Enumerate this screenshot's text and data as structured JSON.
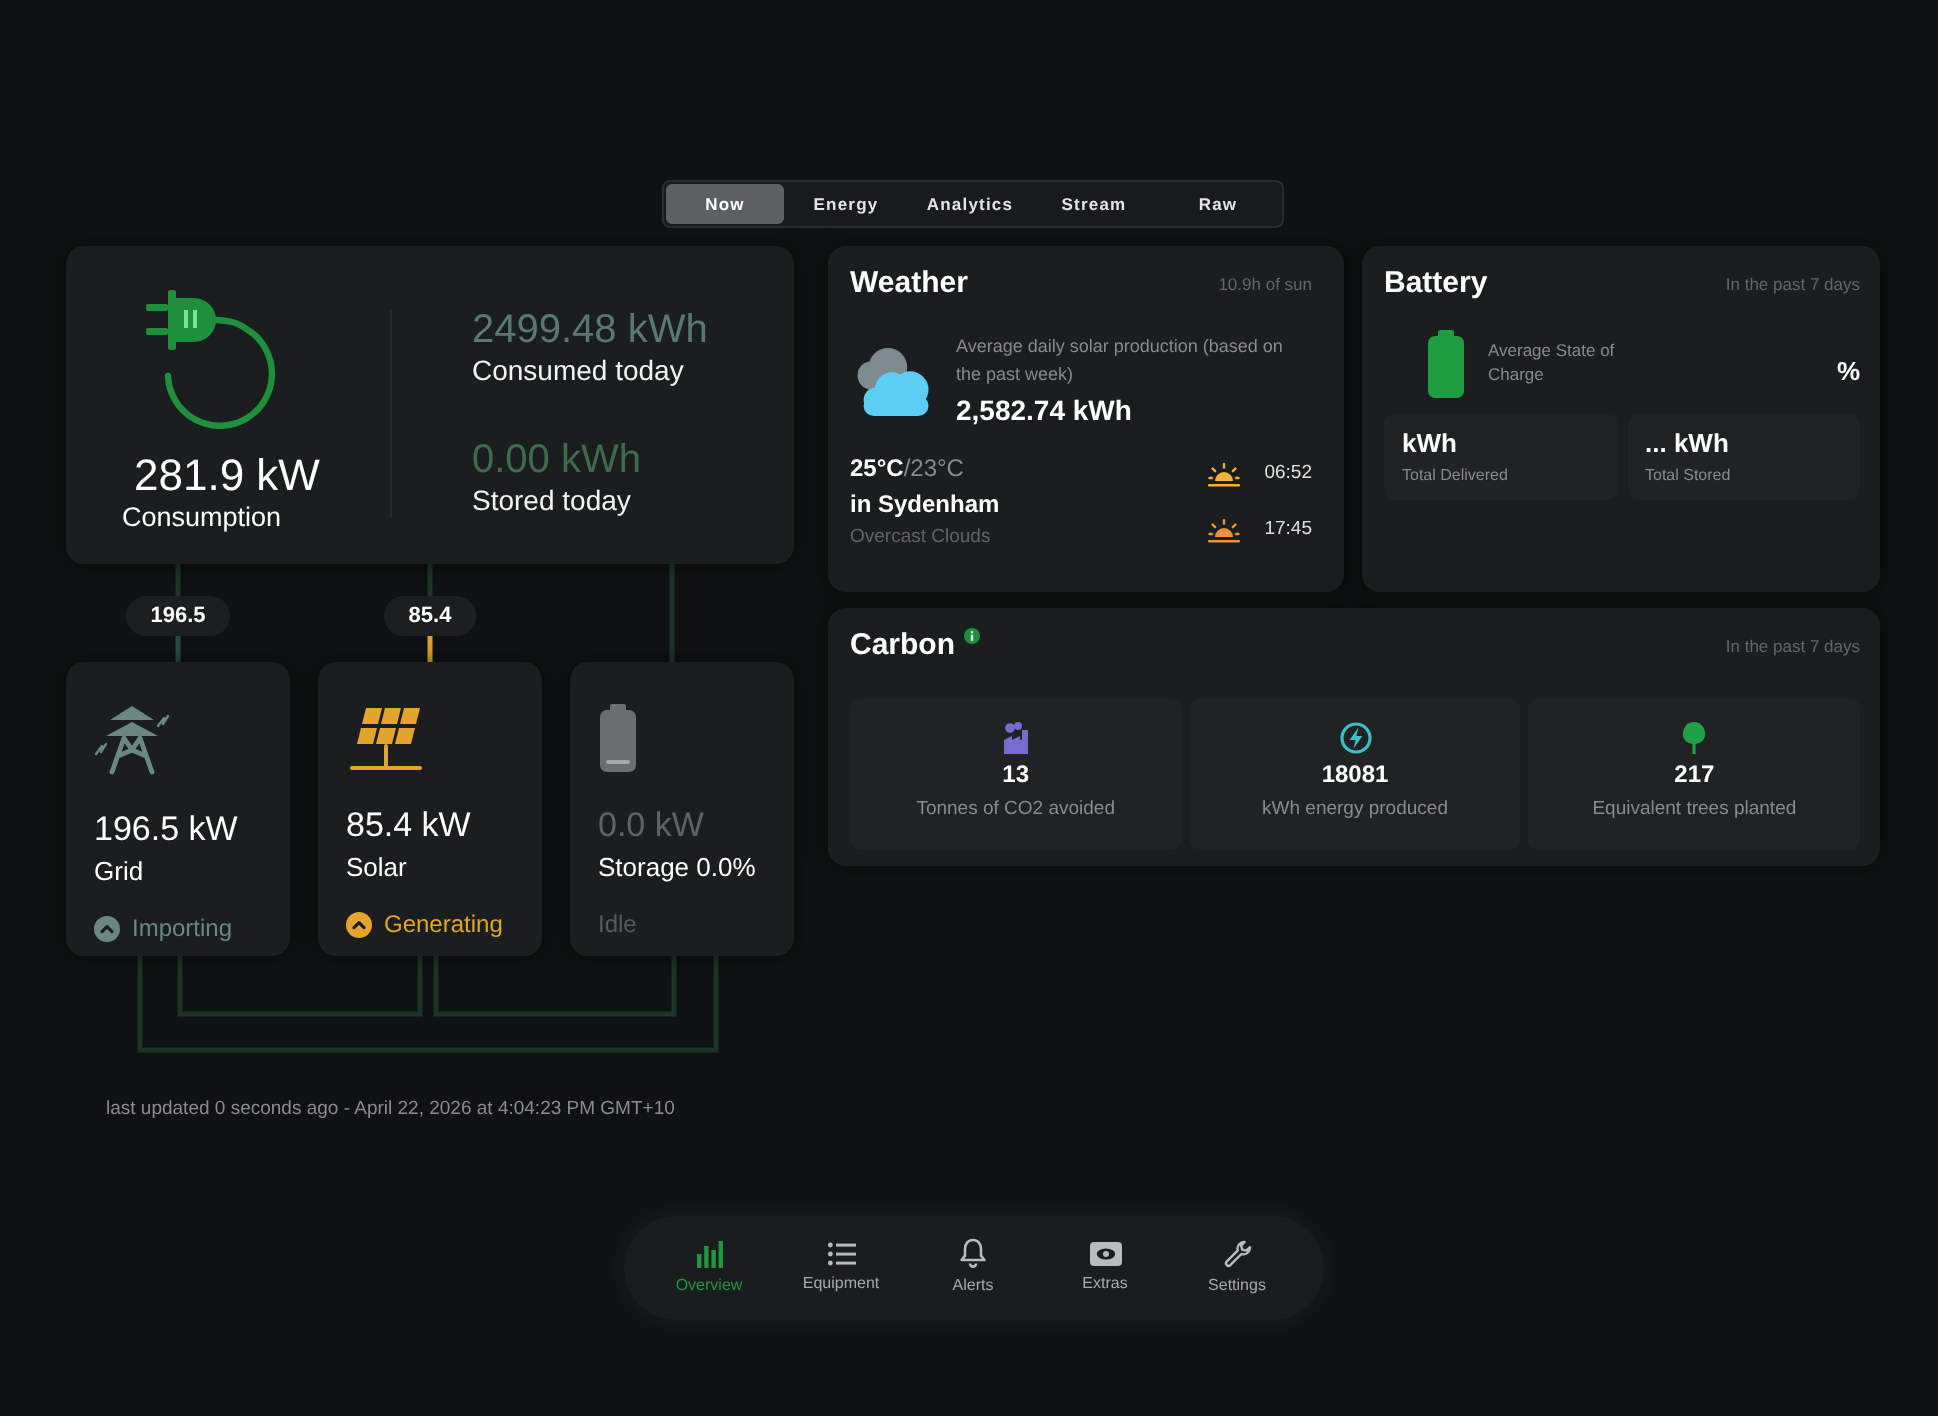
{
  "tabs": [
    {
      "label": "Now",
      "selected": true
    },
    {
      "label": "Energy",
      "selected": false
    },
    {
      "label": "Analytics",
      "selected": false
    },
    {
      "label": "Stream",
      "selected": false
    },
    {
      "label": "Raw",
      "selected": false
    }
  ],
  "consumption": {
    "value": "281.9 kW",
    "label": "Consumption",
    "stats": [
      {
        "value": "2499.48 kWh",
        "label": "Consumed today"
      },
      {
        "value": "0.00 kWh",
        "label": "Stored today"
      }
    ]
  },
  "flow": {
    "badges": [
      {
        "kind": "grid",
        "value": "196.5"
      },
      {
        "kind": "solar",
        "value": "85.4"
      }
    ],
    "sources": [
      {
        "kind": "grid",
        "color": "#6a8780",
        "value": "196.5 kW",
        "label": "Grid",
        "status": "Importing",
        "active": true
      },
      {
        "kind": "solar",
        "color": "#e3a52b",
        "value": "85.4 kW",
        "label": "Solar",
        "status": "Generating",
        "active": true
      },
      {
        "kind": "storage",
        "color": "#6b6e6e",
        "value": "0.0 kW",
        "label": "Storage 0.0%",
        "status": "Idle",
        "active": false
      }
    ]
  },
  "weather": {
    "title": "Weather",
    "note": "10.9h of sun",
    "description": "Average daily solar production (based on the past week)",
    "production": "2,582.74 kWh",
    "temp_high": "25°C",
    "temp_low": "/23°C",
    "location": "in Sydenham",
    "condition": "Overcast Clouds",
    "sun_times": [
      {
        "kind": "sunrise",
        "time": "06:52"
      },
      {
        "kind": "sunset",
        "time": "17:45"
      }
    ]
  },
  "battery": {
    "title": "Battery",
    "note": "In the past 7 days",
    "state_label": "Average State of Charge",
    "state_value": "%",
    "totals": [
      {
        "value": "kWh",
        "label": "Total Delivered"
      },
      {
        "value": "... kWh",
        "label": "Total Stored"
      }
    ]
  },
  "carbon": {
    "title": "Carbon",
    "note": "In the past 7 days",
    "metrics": [
      {
        "kind": "factory",
        "value": "13",
        "label": "Tonnes of CO2 avoided"
      },
      {
        "kind": "energy",
        "value": "18081",
        "label": "kWh energy produced"
      },
      {
        "kind": "tree",
        "value": "217",
        "label": "Equivalent trees planted"
      }
    ]
  },
  "footer": {
    "last_updated": "last updated 0 seconds ago - April 22, 2026 at 4:04:23 PM GMT+10"
  },
  "nav": [
    {
      "kind": "overview",
      "label": "Overview",
      "selected": true
    },
    {
      "kind": "equipment",
      "label": "Equipment",
      "selected": false
    },
    {
      "kind": "alerts",
      "label": "Alerts",
      "selected": false
    },
    {
      "kind": "extras",
      "label": "Extras",
      "selected": false
    },
    {
      "kind": "settings",
      "label": "Settings",
      "selected": false
    }
  ]
}
